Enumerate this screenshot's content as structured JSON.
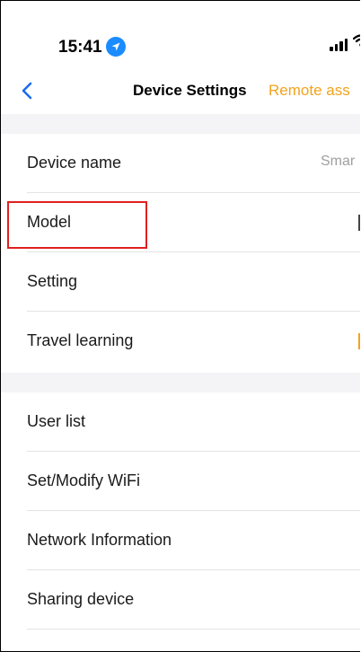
{
  "status_bar": {
    "time": "15:41",
    "location_icon": "location-arrow-icon",
    "signal_icon": "cellular-signal-icon",
    "wifi_icon": "wifi-icon"
  },
  "nav": {
    "back_icon": "chevron-left-icon",
    "title": "Device Settings",
    "action_label": "Remote ass"
  },
  "sections": [
    {
      "items": [
        {
          "label": "Device name",
          "value": "Smar"
        },
        {
          "label": "Model"
        },
        {
          "label": "Setting"
        },
        {
          "label": "Travel learning"
        }
      ]
    },
    {
      "items": [
        {
          "label": "User list"
        },
        {
          "label": "Set/Modify WiFi"
        },
        {
          "label": "Network Information"
        },
        {
          "label": "Sharing device"
        }
      ]
    }
  ],
  "colors": {
    "accent": "#f2a31c",
    "back_blue": "#1a6cf0",
    "location_blue": "#1a8cff",
    "highlight_red": "#e0201e",
    "section_gap": "#f4f4f6"
  }
}
